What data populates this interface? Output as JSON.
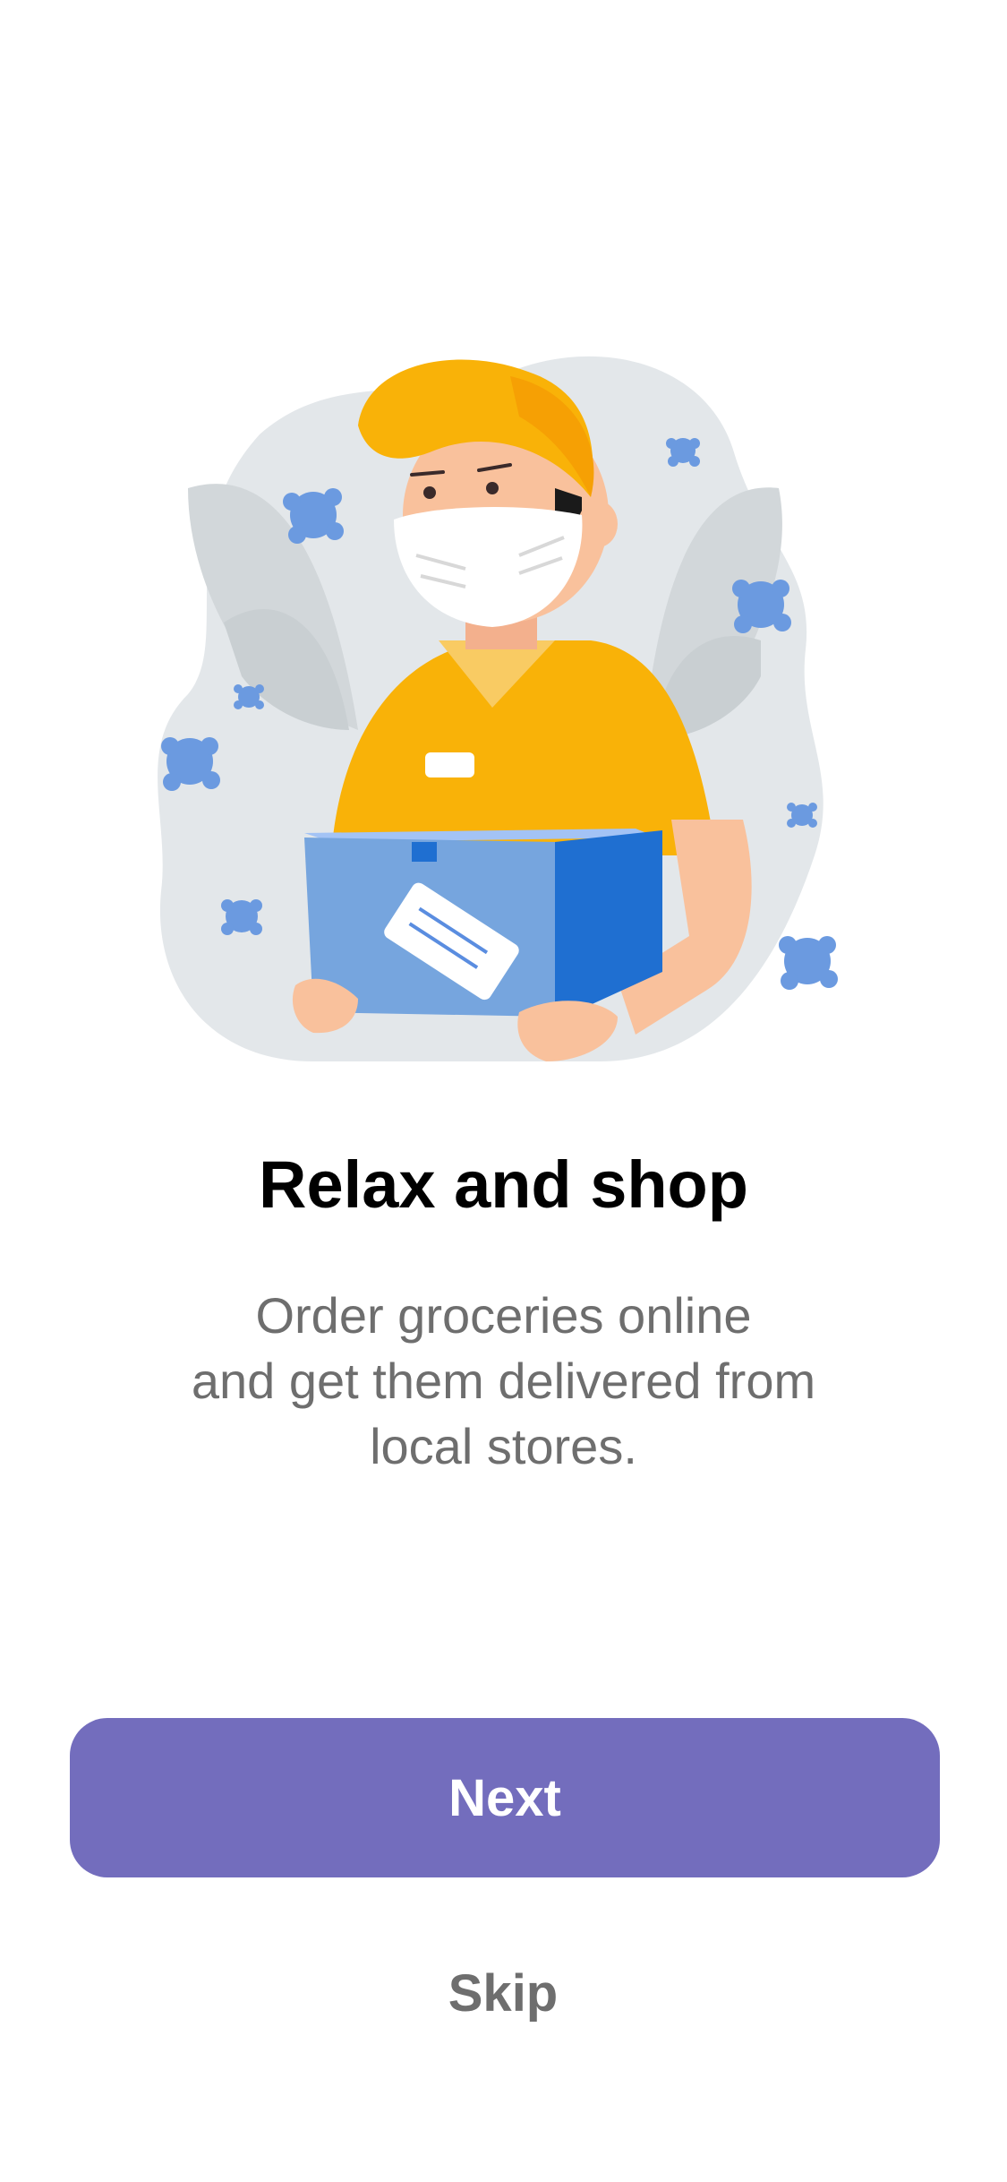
{
  "onboarding": {
    "title": "Relax and shop",
    "subtitle_lines": [
      "Order groceries online",
      "and get them delivered from",
      "local stores."
    ],
    "illustration_icon": "delivery-person-with-box-icon"
  },
  "actions": {
    "next_label": "Next",
    "skip_label": "Skip"
  },
  "colors": {
    "primary": "#736dbd",
    "text_primary": "#000000",
    "text_secondary": "#6e6e6e",
    "background": "#ffffff"
  }
}
